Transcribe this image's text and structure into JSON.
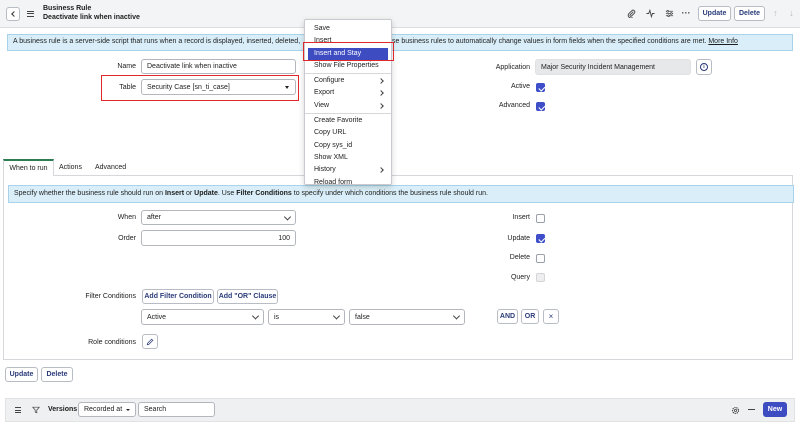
{
  "header": {
    "record_type": "Business Rule",
    "record_name": "Deactivate link when inactive",
    "update_label": "Update",
    "delete_label": "Delete"
  },
  "info_banner": {
    "text_start": "A business rule is a server-side script that runs when a record is displayed, inserted, deleted,",
    "text_end": "se business rules to automatically change values in form fields when the specified conditions are met.",
    "link": "More Info"
  },
  "form": {
    "name_label": "Name",
    "name_value": "Deactivate link when inactive",
    "table_label": "Table",
    "table_value": "Security Case [sn_ti_case]",
    "application_label": "Application",
    "application_value": "Major Security Incident Management",
    "active_label": "Active",
    "advanced_label": "Advanced"
  },
  "context_menu": {
    "items": [
      "Save",
      "Insert",
      "Insert and Stay",
      "Show File Properties",
      "Configure",
      "Export",
      "View",
      "Create Favorite",
      "Copy URL",
      "Copy sys_id",
      "Show XML",
      "History",
      "Reload form"
    ]
  },
  "tabs": [
    "When to run",
    "Actions",
    "Advanced"
  ],
  "when_to_run": {
    "banner_html_parts": [
      "Specify whether the business rule should run on ",
      "Insert",
      " or ",
      "Update",
      ". Use ",
      "Filter Conditions",
      " to specify under which conditions the business rule should run."
    ],
    "when_label": "When",
    "when_value": "after",
    "order_label": "Order",
    "order_value": "100",
    "insert_label": "Insert",
    "update_label": "Update",
    "delete_label": "Delete",
    "query_label": "Query",
    "filter_label": "Filter Conditions",
    "add_filter_label": "Add Filter Condition",
    "add_or_label": "Add \"OR\" Clause",
    "cond_field": "Active",
    "cond_operator": "is",
    "cond_value": "false",
    "and_label": "AND",
    "or_label": "OR",
    "role_label": "Role conditions"
  },
  "footer": {
    "update_label": "Update",
    "delete_label": "Delete"
  },
  "versions": {
    "title": "Versions",
    "filter_value": "Recorded at",
    "search_placeholder": "Search",
    "new_label": "New"
  },
  "colors": {
    "accent": "#3e4cc1",
    "banner_bg": "#d9eef8",
    "highlight_red": "#e0292b",
    "tab_active": "#2e7d52"
  }
}
